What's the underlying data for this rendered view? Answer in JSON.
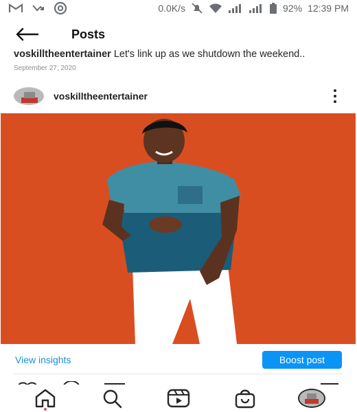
{
  "status_bar": {
    "network_speed": "0.0K/s",
    "battery": "92%",
    "time": "12:39 PM",
    "icons": [
      "gmail-icon",
      "missed-call-icon",
      "chrome-icon",
      "mute-icon",
      "wifi-icon",
      "signal-icon",
      "signal-icon",
      "battery-icon"
    ]
  },
  "header": {
    "title": "Posts",
    "back_icon": "arrow-left-icon"
  },
  "post": {
    "username": "voskilltheentertainer",
    "caption_text": "Let's link up as we shutdown the weekend..",
    "date": "September 27, 2020",
    "more_icon": "more-vertical-icon",
    "image_background": "#d94e20"
  },
  "actions": {
    "view_insights": "View insights",
    "boost_post": "Boost post"
  },
  "bottom_nav": {
    "items": [
      "home-icon",
      "search-icon",
      "reels-icon",
      "shop-icon",
      "profile-avatar"
    ]
  },
  "colors": {
    "accent": "#0a95f6",
    "link": "#1a8fd6",
    "notification_dot": "#ed4956"
  }
}
